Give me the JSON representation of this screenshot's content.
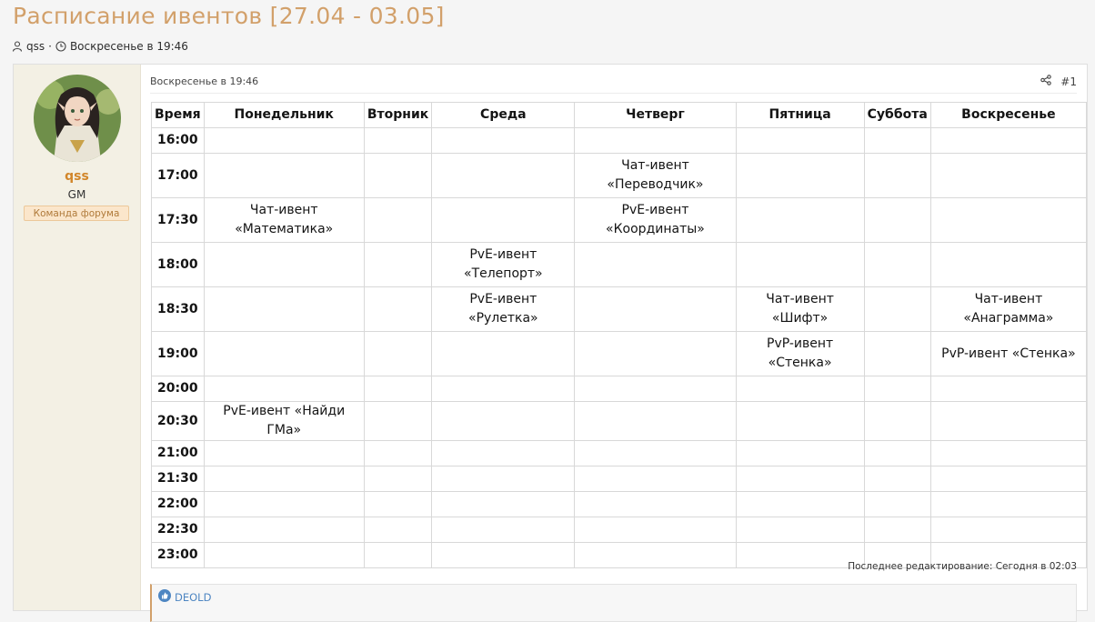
{
  "thread": {
    "title": "Расписание ивентов [27.04 - 03.05]",
    "author": "qss",
    "date": "Воскресенье в 19:46"
  },
  "user": {
    "name": "qss",
    "title": "GM",
    "banner": "Команда форума"
  },
  "post": {
    "date": "Воскресенье в 19:46",
    "number": "#1",
    "last_edit": "Последнее редактирование: Сегодня в 02:03",
    "reaction_user": "DEOLD"
  },
  "schedule": {
    "headers": [
      "Время",
      "Понедельник",
      "Вторник",
      "Среда",
      "Четверг",
      "Пятница",
      "Суббота",
      "Воскресенье"
    ],
    "rows": [
      [
        "16:00",
        "",
        "",
        "",
        "",
        "",
        "",
        ""
      ],
      [
        "17:00",
        "",
        "",
        "",
        "Чат-ивент «Переводчик»",
        "",
        "",
        ""
      ],
      [
        "17:30",
        "Чат-ивент «Математика»",
        "",
        "",
        "PvE-ивент «Координаты»",
        "",
        "",
        ""
      ],
      [
        "18:00",
        "",
        "",
        "PvE-ивент «Телепорт»",
        "",
        "",
        "",
        ""
      ],
      [
        "18:30",
        "",
        "",
        "PvE-ивент «Рулетка»",
        "",
        "Чат-ивент «Шифт»",
        "",
        "Чат-ивент «Анаграмма»"
      ],
      [
        "19:00",
        "",
        "",
        "",
        "",
        "PvP-ивент «Стенка»",
        "",
        "PvP-ивент «Стенка»"
      ],
      [
        "20:00",
        "",
        "",
        "",
        "",
        "",
        "",
        ""
      ],
      [
        "20:30",
        "PvE-ивент «Найди ГМа»",
        "",
        "",
        "",
        "",
        "",
        ""
      ],
      [
        "21:00",
        "",
        "",
        "",
        "",
        "",
        "",
        ""
      ],
      [
        "21:30",
        "",
        "",
        "",
        "",
        "",
        "",
        ""
      ],
      [
        "22:00",
        "",
        "",
        "",
        "",
        "",
        "",
        ""
      ],
      [
        "22:30",
        "",
        "",
        "",
        "",
        "",
        "",
        ""
      ],
      [
        "23:00",
        "",
        "",
        "",
        "",
        "",
        "",
        ""
      ]
    ]
  },
  "icons": {
    "user": "user-icon",
    "clock": "clock-icon",
    "share": "share-icon",
    "like": "like-icon"
  },
  "colors": {
    "title": "#d2a06a",
    "username": "#d2862a",
    "banner_bg": "#fbe6cb",
    "link": "#4e86c2"
  }
}
